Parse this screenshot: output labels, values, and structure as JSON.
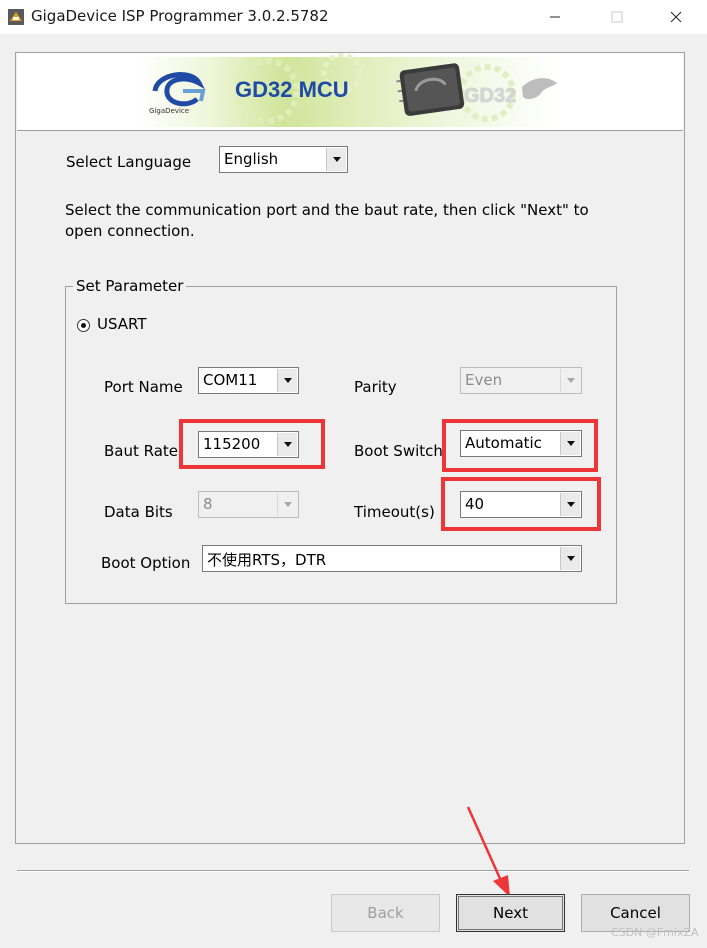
{
  "window": {
    "title": "GigaDevice ISP Programmer 3.0.2.5782",
    "minimize_icon": "minimize-icon",
    "maximize_icon": "maximize-icon",
    "close_icon": "close-icon"
  },
  "banner": {
    "brand": "GigaDevice",
    "title": "GD32 MCU",
    "chip_text": "GD32",
    "accent_color": "#1f4ba6"
  },
  "language": {
    "label": "Select Language",
    "value": "English"
  },
  "instruction": "Select the communication port and the baut rate, then click \"Next\" to open connection.",
  "set_parameter": {
    "title": "Set Parameter",
    "usart_label": "USART",
    "port_name": {
      "label": "Port Name",
      "value": "COM11"
    },
    "parity": {
      "label": "Parity",
      "value": "Even"
    },
    "baut_rate": {
      "label": "Baut Rate",
      "value": "115200"
    },
    "boot_switch": {
      "label": "Boot Switch",
      "value": "Automatic"
    },
    "data_bits": {
      "label": "Data Bits",
      "value": "8"
    },
    "timeout": {
      "label": "Timeout(s)",
      "value": "40"
    },
    "boot_option": {
      "label": "Boot Option",
      "value": "不使用RTS，DTR"
    }
  },
  "annotation_color": "#ee3538",
  "buttons": {
    "back": "Back",
    "next": "Next",
    "cancel": "Cancel"
  },
  "watermark": "CSDN @FmixZA"
}
